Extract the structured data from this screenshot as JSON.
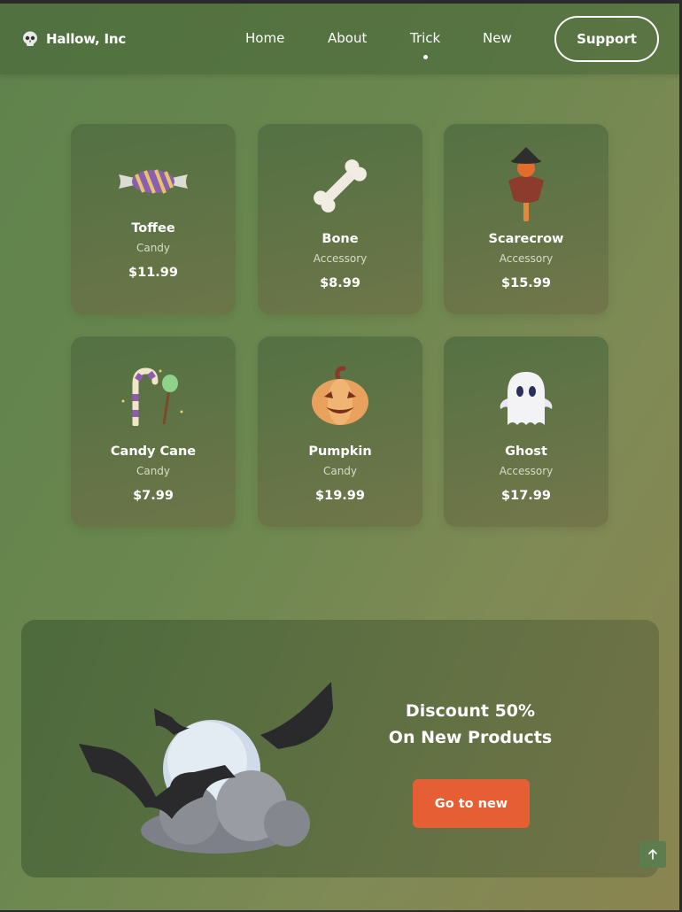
{
  "brand": {
    "name": "Hallow, Inc",
    "icon": "skull-icon"
  },
  "nav": {
    "items": [
      {
        "label": "Home",
        "active": false
      },
      {
        "label": "About",
        "active": false
      },
      {
        "label": "Trick",
        "active": true
      },
      {
        "label": "New",
        "active": false
      }
    ],
    "support_label": "Support"
  },
  "products": [
    {
      "name": "Toffee",
      "category": "Candy",
      "price": "$11.99",
      "icon": "toffee-candy-icon"
    },
    {
      "name": "Bone",
      "category": "Accessory",
      "price": "$8.99",
      "icon": "bone-icon"
    },
    {
      "name": "Scarecrow",
      "category": "Accessory",
      "price": "$15.99",
      "icon": "scarecrow-icon"
    },
    {
      "name": "Candy Cane",
      "category": "Candy",
      "price": "$7.99",
      "icon": "candy-cane-icon"
    },
    {
      "name": "Pumpkin",
      "category": "Candy",
      "price": "$19.99",
      "icon": "pumpkin-icon"
    },
    {
      "name": "Ghost",
      "category": "Accessory",
      "price": "$17.99",
      "icon": "ghost-icon"
    }
  ],
  "banner": {
    "title_line1": "Discount 50%",
    "title_line2": "On New Products",
    "button_label": "Go to new",
    "art": "moon-bats-cloud-illustration"
  },
  "colors": {
    "accent_button": "#e55e34",
    "card_bg": "#5a7a4a"
  },
  "scroll_top_icon": "arrow-up-icon"
}
